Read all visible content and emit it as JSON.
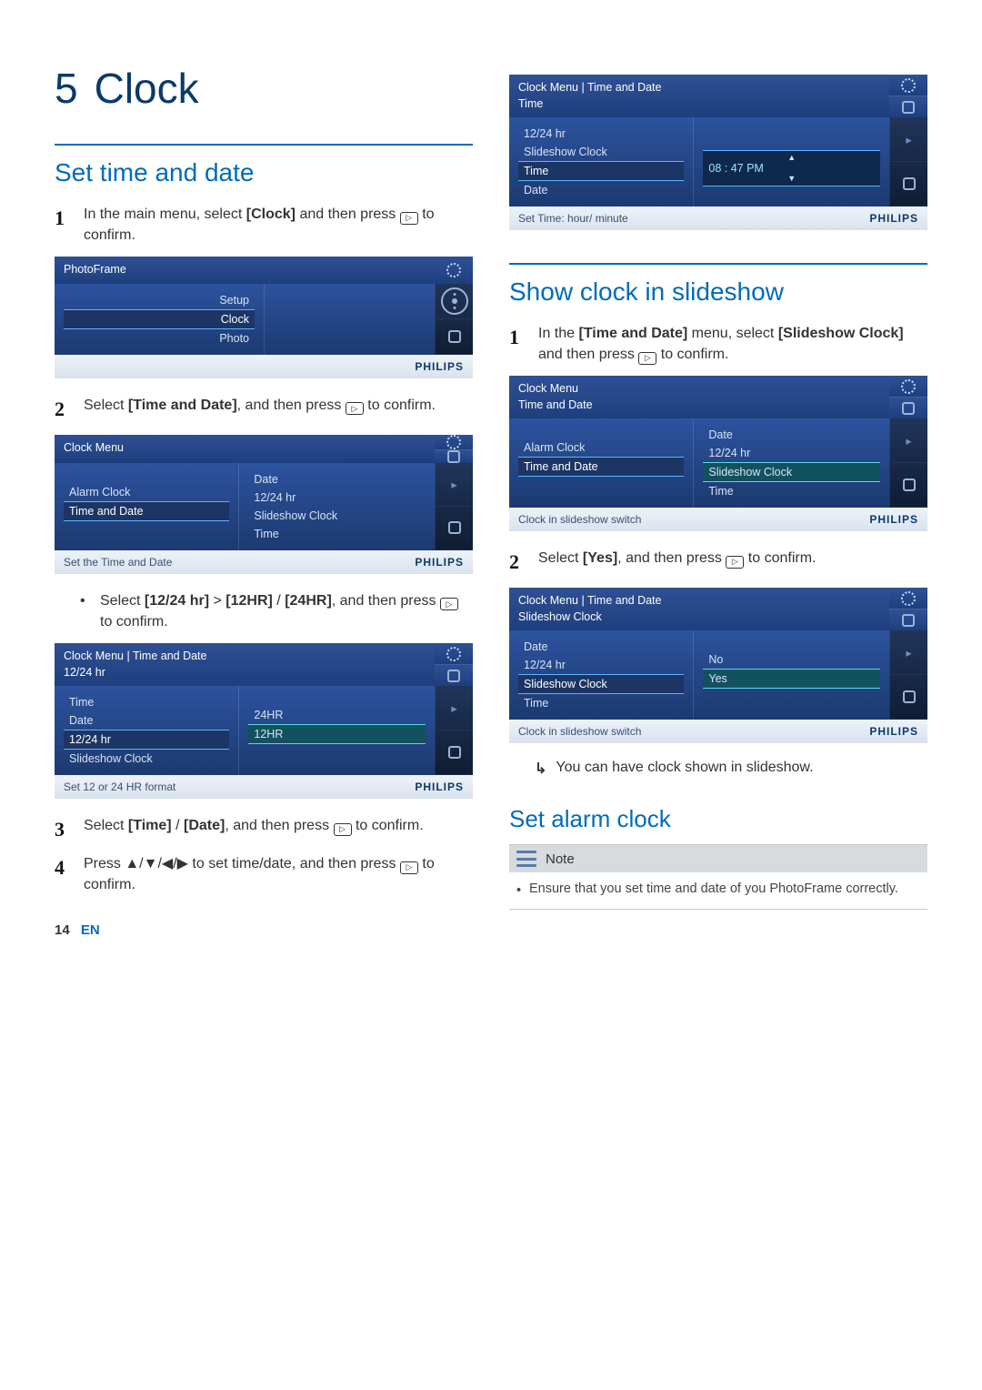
{
  "chapter": {
    "number": "5",
    "title": "Clock"
  },
  "left": {
    "section1": "Set time and date",
    "step1_num": "1",
    "step1": "In the main menu, select [Clock] and then press   to confirm.",
    "step2_num": "2",
    "step2": "Select [Time and Date], and then press   to confirm.",
    "bullet1": "Select [12/24 hr] > [12HR] / [24HR], and then press   to confirm.",
    "step3_num": "3",
    "step3": "Select [Time] / [Date], and then press   to confirm.",
    "step4_num": "4",
    "step4": "Press ▲/▼/◀/▶ to set time/date, and then press   to confirm."
  },
  "right": {
    "section1": "Show clock in slideshow",
    "s2_step1_num": "1",
    "s2_step1": "In the [Time and Date] menu, select [Slideshow Clock] and then press   to confirm.",
    "s2_step2_num": "2",
    "s2_step2": "Select [Yes], and then press   to confirm.",
    "result1": "You can have clock shown in slideshow.",
    "section2": "Set alarm clock",
    "note_label": "Note",
    "note_body": "Ensure that you set time and date of you PhotoFrame correctly."
  },
  "shots": {
    "pf": {
      "title": "PhotoFrame",
      "items": [
        "Setup",
        "Clock",
        "Photo"
      ],
      "selected": "Clock",
      "status": "",
      "brand": "PHILIPS"
    },
    "cm": {
      "title": "Clock Menu",
      "left": [
        "Alarm Clock",
        "Time and Date"
      ],
      "left_selected": "Time and Date",
      "right": [
        "Date",
        "12/24 hr",
        "Slideshow Clock",
        "Time"
      ],
      "status": "Set the Time and Date",
      "brand": "PHILIPS"
    },
    "hr": {
      "title1": "Clock Menu | Time and  Date",
      "title2": "12/24 hr",
      "left": [
        "Time",
        "Date",
        "12/24 hr",
        "Slideshow Clock"
      ],
      "left_selected": "12/24 hr",
      "right": [
        "24HR",
        "12HR"
      ],
      "right_selected": "12HR",
      "status": "Set 12 or 24 HR format",
      "brand": "PHILIPS"
    },
    "time": {
      "title1": "Clock Menu | Time and  Date",
      "title2": "Time",
      "left": [
        "12/24 hr",
        "Slideshow Clock",
        "Time",
        "Date"
      ],
      "left_selected": "Time",
      "value": "08 : 47  PM",
      "status": "Set Time: hour/ minute",
      "brand": "PHILIPS"
    },
    "cm2": {
      "title1": "Clock Menu",
      "title2": "Time and Date",
      "left": [
        "Alarm Clock",
        "Time and Date"
      ],
      "left_selected": "Time and Date",
      "right": [
        "Date",
        "12/24 hr",
        "Slideshow Clock",
        "Time"
      ],
      "right_selected": "Slideshow Clock",
      "status": "Clock in slideshow switch",
      "brand": "PHILIPS"
    },
    "ssc": {
      "title1": "Clock Menu | Time and  Date",
      "title2": "Slideshow Clock",
      "left": [
        "Date",
        "12/24 hr",
        "Slideshow Clock",
        "Time"
      ],
      "left_selected": "Slideshow Clock",
      "right": [
        "No",
        "Yes"
      ],
      "right_selected": "Yes",
      "status": "Clock in slideshow switch",
      "brand": "PHILIPS"
    }
  },
  "footer": {
    "page": "14",
    "lang": "EN"
  }
}
